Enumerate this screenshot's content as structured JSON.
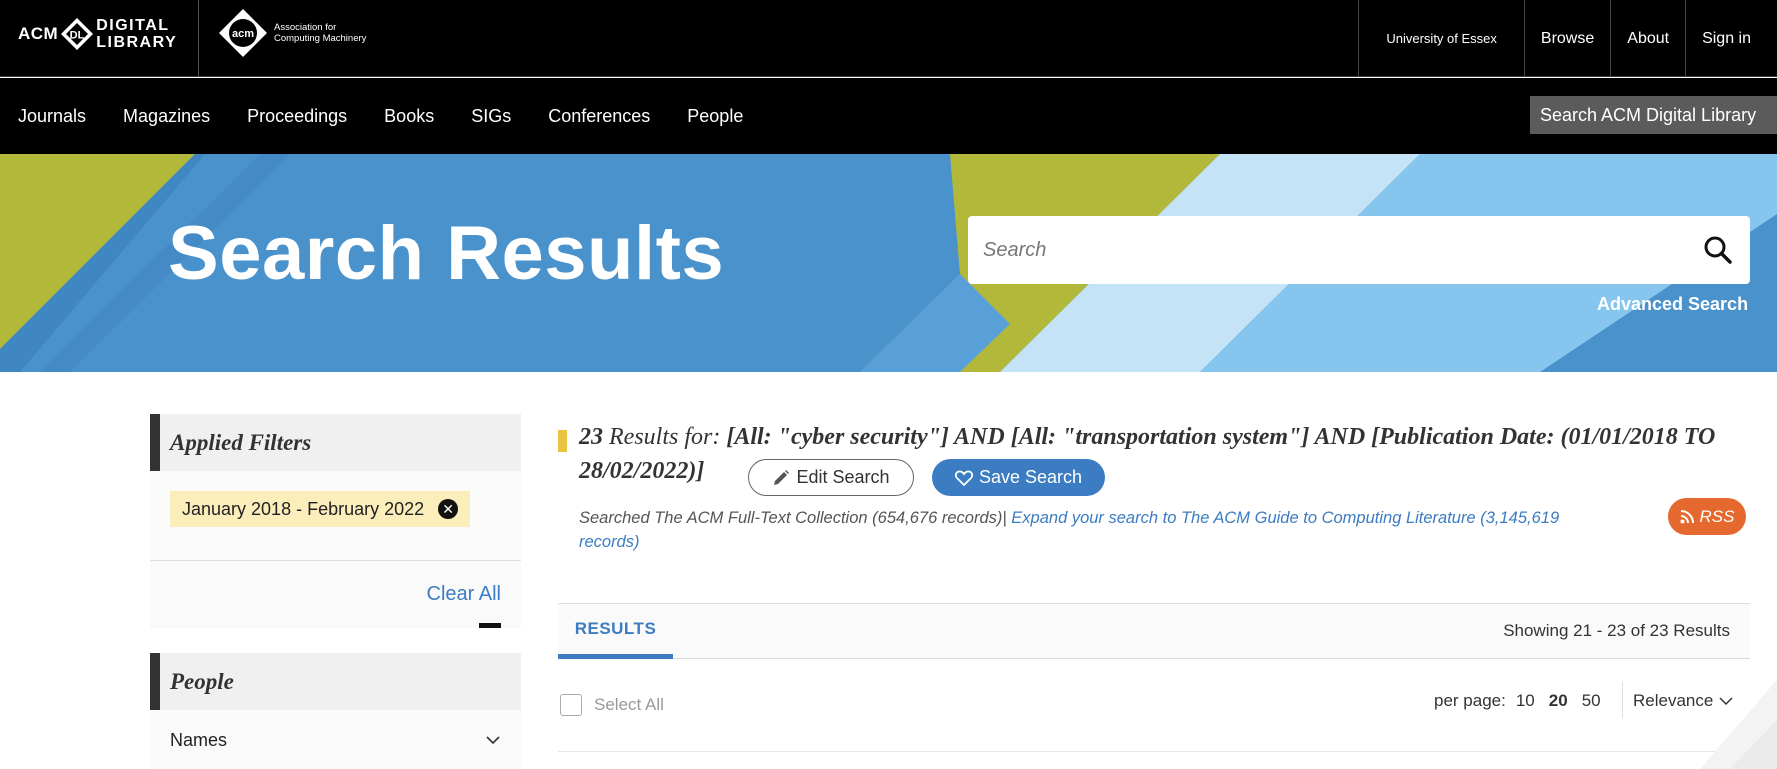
{
  "header": {
    "dl_logo": {
      "acm": "ACM",
      "badge": "DL",
      "line1": "DIGITAL",
      "line2": "LIBRARY"
    },
    "org_logo": {
      "badge": "acm",
      "line1": "Association for",
      "line2": "Computing Machinery"
    },
    "links": [
      "University of Essex",
      "Browse",
      "About",
      "Sign in"
    ]
  },
  "nav": {
    "items": [
      "Journals",
      "Magazines",
      "Proceedings",
      "Books",
      "SIGs",
      "Conferences",
      "People"
    ],
    "search_label": "Search ACM Digital Library"
  },
  "banner": {
    "title": "Search Results",
    "search_placeholder": "Search",
    "advanced_search": "Advanced Search"
  },
  "sidebar": {
    "applied_filters_title": "Applied Filters",
    "filter_chip": "January 2018 - February 2022",
    "clear_all": "Clear All",
    "people_title": "People",
    "names_label": "Names"
  },
  "results": {
    "count": "23",
    "results_for_label": "Results for:",
    "query": "[All: \"cyber security\"] AND [All: \"transportation system\"] AND [Publication Date: (01/01/2018 TO 28/02/2022)]",
    "edit_search": "Edit Search",
    "save_search": "Save Search",
    "searched_text": "Searched The ACM Full-Text Collection (654,676 records)",
    "separator": "|",
    "expand_text": "Expand your search to The ACM Guide to Computing Literature (3,145,619 records)",
    "rss": "RSS",
    "tab_label": "RESULTS",
    "showing": "Showing 21 - 23  of 23 Results",
    "select_all": "Select All",
    "per_page_label": "per page:",
    "per_page_options": [
      "10",
      "20",
      "50"
    ],
    "per_page_selected": "20",
    "sort": "Relevance"
  },
  "colors": {
    "accent_blue": "#3b7cc2",
    "banner_blue": "#4a92cc",
    "banner_green": "#b2b83a",
    "chip_yellow": "#fbeebb",
    "rss_orange": "#e5692e"
  }
}
